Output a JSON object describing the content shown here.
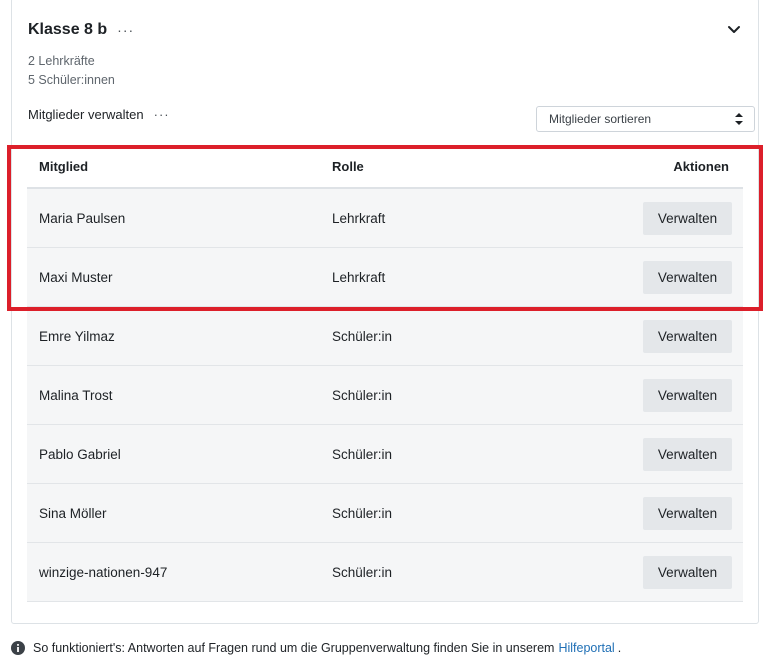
{
  "group": {
    "title": "Klasse 8 b",
    "teacher_count": "2 Lehrkräfte",
    "student_count": "5 Schüler:innen",
    "manage_label": "Mitglieder verwalten",
    "sort_label": "Mitglieder sortieren"
  },
  "table": {
    "headers": {
      "member": "Mitglied",
      "role": "Rolle",
      "actions": "Aktionen"
    },
    "action_label": "Verwalten",
    "rows": [
      {
        "name": "Maria Paulsen",
        "role": "Lehrkraft"
      },
      {
        "name": "Maxi Muster",
        "role": "Lehrkraft"
      },
      {
        "name": "Emre Yilmaz",
        "role": "Schüler:in"
      },
      {
        "name": "Malina Trost",
        "role": "Schüler:in"
      },
      {
        "name": "Pablo Gabriel",
        "role": "Schüler:in"
      },
      {
        "name": "Sina Möller",
        "role": "Schüler:in"
      },
      {
        "name": "winzige-nationen-947",
        "role": "Schüler:in"
      }
    ]
  },
  "footer": {
    "text": "So funktioniert's: Antworten auf Fragen rund um die Gruppenverwaltung finden Sie in unserem",
    "link": "Hilfeportal",
    "suffix": "."
  },
  "colors": {
    "highlight": "#dc1f2a",
    "link": "#1f6fb5",
    "button_bg": "#e4e7ea",
    "row_bg": "#f5f6f7"
  },
  "icons": [
    "more-dots-icon",
    "chevron-down-icon",
    "sort-updown-icon",
    "info-icon"
  ]
}
